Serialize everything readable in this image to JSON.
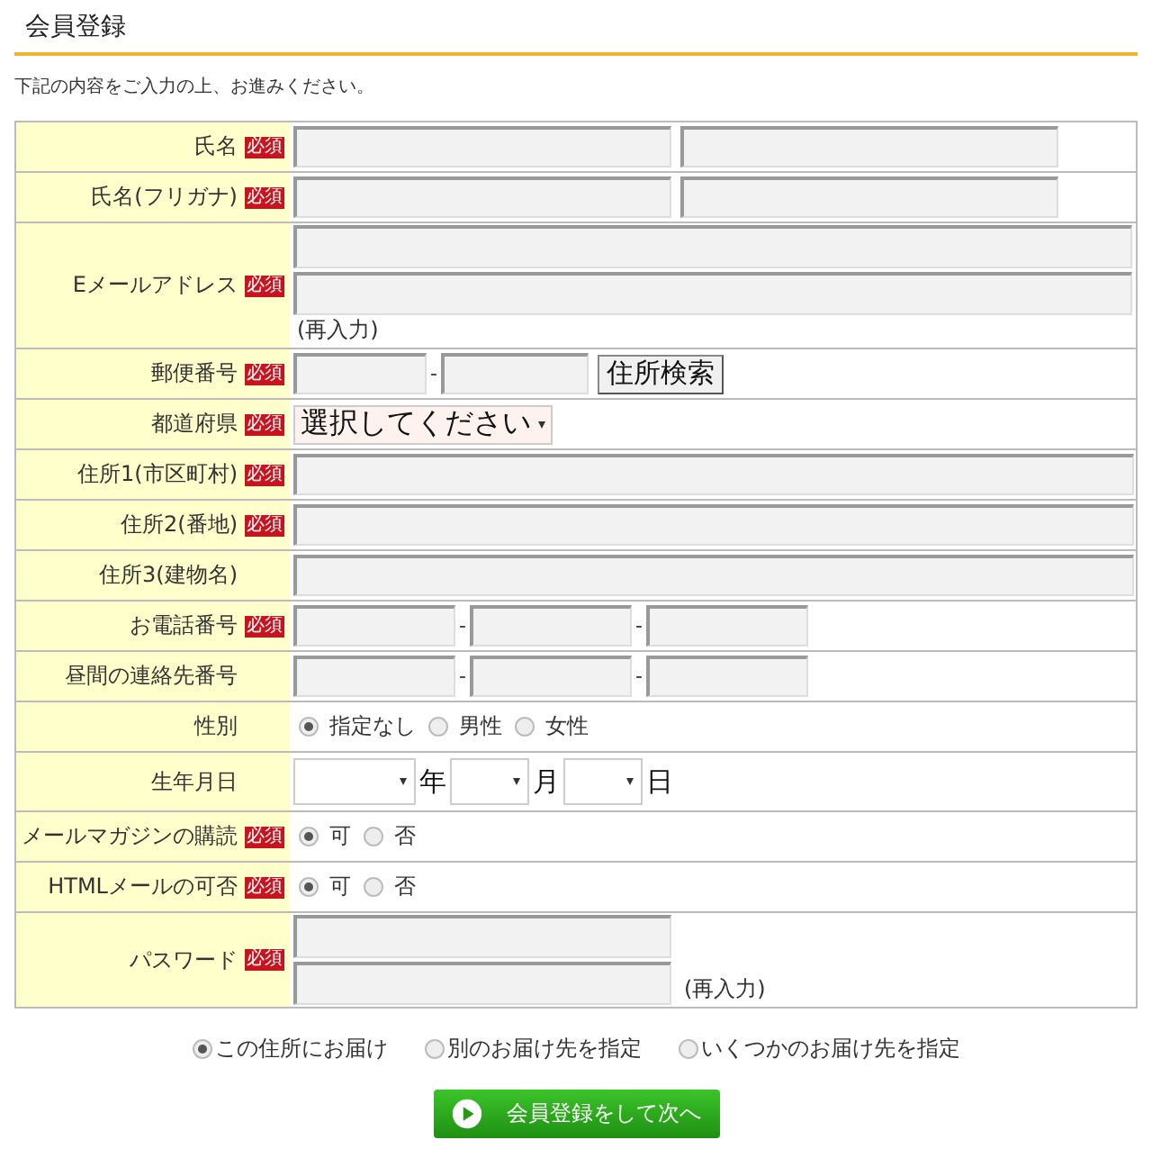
{
  "title": "会員登録",
  "intro": "下記の内容をご入力の上、お進みください。",
  "rows": [
    {
      "label": "氏名",
      "badge": "必須",
      "kind": "pair"
    },
    {
      "label": "氏名(フリガナ)",
      "badge": "必須",
      "kind": "pair"
    },
    {
      "label": "Eメールアドレス",
      "badge": "必須",
      "kind": "email",
      "note": "(再入力)"
    },
    {
      "label": "郵便番号",
      "badge": "必須",
      "kind": "postal",
      "separator": "-",
      "button": "住所検索"
    },
    {
      "label": "都道府県",
      "badge": "必須",
      "kind": "select",
      "value": "選択してください"
    },
    {
      "label": "住所1(市区町村)",
      "badge": "必須",
      "kind": "text"
    },
    {
      "label": "住所2(番地)",
      "badge": "必須",
      "kind": "text"
    },
    {
      "label": "住所3(建物名)",
      "kind": "text"
    },
    {
      "label": "お電話番号",
      "badge": "必須",
      "kind": "phone",
      "separators": [
        "-",
        "-"
      ]
    },
    {
      "label": "昼間の連絡先番号",
      "kind": "phone",
      "separators": [
        "-",
        "-"
      ]
    },
    {
      "label": "性別",
      "kind": "radio",
      "options": [
        {
          "label": "指定なし",
          "selected": true
        },
        {
          "label": "男性",
          "selected": false
        },
        {
          "label": "女性",
          "selected": false
        }
      ]
    },
    {
      "label": "生年月日",
      "kind": "date",
      "units": [
        "年",
        "月",
        "日"
      ]
    },
    {
      "label": "メールマガジンの購読",
      "badge": "必須",
      "kind": "radio",
      "options": [
        {
          "label": "可",
          "selected": true
        },
        {
          "label": "否",
          "selected": false
        }
      ]
    },
    {
      "label": "HTMLメールの可否",
      "badge": "必須",
      "kind": "radio",
      "options": [
        {
          "label": "可",
          "selected": true
        },
        {
          "label": "否",
          "selected": false
        }
      ]
    },
    {
      "label": "パスワード",
      "badge": "必須",
      "kind": "password",
      "note": "(再入力)"
    }
  ],
  "delivery": [
    {
      "label": "この住所にお届け",
      "selected": true
    },
    {
      "label": "別のお届け先を指定",
      "selected": false
    },
    {
      "label": "いくつかのお届け先を指定",
      "selected": false
    }
  ],
  "submit": "会員登録をして次へ"
}
